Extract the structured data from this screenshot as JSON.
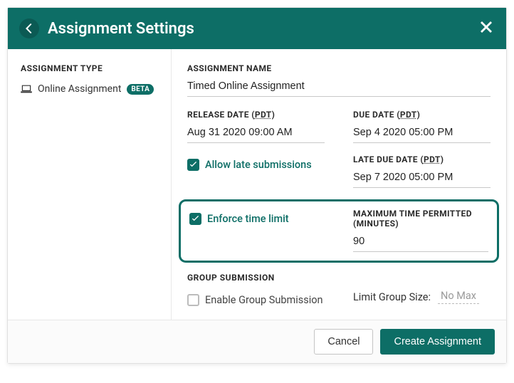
{
  "header": {
    "title": "Assignment Settings"
  },
  "sidebar": {
    "heading": "ASSIGNMENT TYPE",
    "item_label": "Online Assignment",
    "badge": "BETA"
  },
  "main": {
    "name_label": "ASSIGNMENT NAME",
    "name_value": "Timed Online Assignment",
    "release_label_prefix": "RELEASE DATE (",
    "release_label_tz": "PDT",
    "release_label_suffix": ")",
    "release_value": "Aug 31 2020 09:00 AM",
    "due_label_prefix": "DUE DATE (",
    "due_label_tz": "PDT",
    "due_label_suffix": ")",
    "due_value": "Sep 4 2020 05:00 PM",
    "allow_late_label": "Allow late submissions",
    "late_due_label_prefix": "LATE DUE DATE (",
    "late_due_label_tz": "PDT",
    "late_due_label_suffix": ")",
    "late_due_value": "Sep 7 2020 05:00 PM",
    "enforce_label": "Enforce time limit",
    "max_time_label": "MAXIMUM TIME PERMITTED (MINUTES)",
    "max_time_value": "90",
    "group_heading": "GROUP SUBMISSION",
    "enable_group_label": "Enable Group Submission",
    "limit_group_label": "Limit Group Size:",
    "limit_group_value": "No Max"
  },
  "footer": {
    "cancel": "Cancel",
    "create": "Create Assignment"
  }
}
